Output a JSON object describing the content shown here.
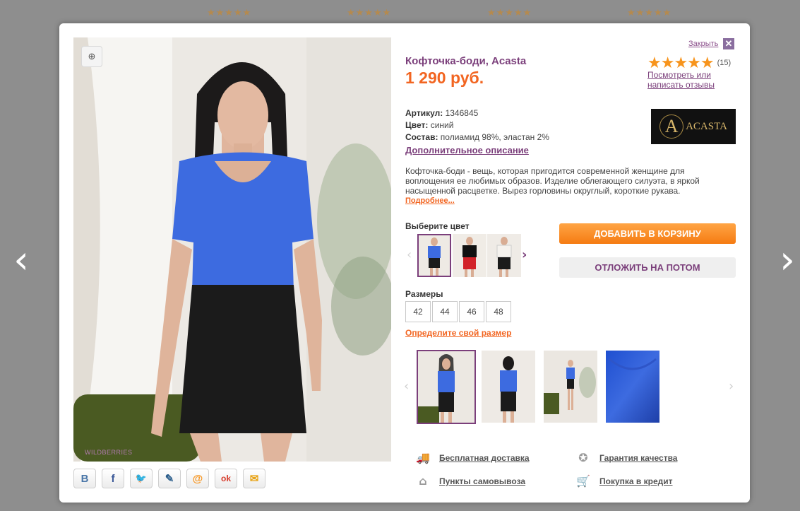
{
  "background": {
    "star_rows": [
      "★★★★★",
      "★★★★★",
      "★★★★★",
      "★★★★★"
    ],
    "prev_arrow": "‹",
    "next_arrow": "›"
  },
  "modal": {
    "close_label": "Закрыть",
    "close_icon": "✕",
    "title": "Кофточка-боди, Acasta",
    "price": "1 290 руб.",
    "rating": {
      "stars": "★★★★★",
      "count": "(15)",
      "link": "Посмотреть или написать отзывы"
    },
    "brand": {
      "monogram": "A",
      "name": "ACASTA"
    },
    "specs": [
      {
        "label": "Артикул:",
        "value": "1346845"
      },
      {
        "label": "Цвет:",
        "value": "синий"
      },
      {
        "label": "Состав:",
        "value": "полиамид 98%, эластан 2%"
      }
    ],
    "more_description": "Дополнительное описание",
    "description": "Кофточка-боди - вещь, которая пригодится современной женщине для воплощения ее любимых образов. Изделие облегающего силуэта, в яркой насыщенной расцветке. Вырез горловины округлый, короткие рукава.",
    "read_more": "Подробнее...",
    "color_label": "Выберите цвет",
    "colors": [
      "синий",
      "красный",
      "белый"
    ],
    "add_to_cart": "ДОБАВИТЬ В КОРЗИНУ",
    "save_later": "ОТЛОЖИТЬ НА ПОТОМ",
    "sizes_label": "Размеры",
    "sizes": [
      "42",
      "44",
      "46",
      "48"
    ],
    "size_help": "Определите свой размер",
    "watermark": "WILDBERRIES",
    "zoom_icon": "⊕",
    "services": [
      {
        "icon": "delivery-truck-icon",
        "label": "Бесплатная доставка"
      },
      {
        "icon": "quality-badge-icon",
        "label": "Гарантия качества"
      },
      {
        "icon": "pickup-point-icon",
        "label": "Пункты самовывоза"
      },
      {
        "icon": "credit-cart-icon",
        "label": "Покупка в кредит"
      }
    ],
    "share": [
      {
        "name": "vk",
        "glyph": "B",
        "color": "#4a76a8"
      },
      {
        "name": "facebook",
        "glyph": "f",
        "color": "#3b5998"
      },
      {
        "name": "twitter",
        "glyph": "🐦",
        "color": "#1da1f2"
      },
      {
        "name": "livejournal",
        "glyph": "✎",
        "color": "#2b5e8c"
      },
      {
        "name": "mail",
        "glyph": "@",
        "color": "#f7941d"
      },
      {
        "name": "odnoklassniki",
        "glyph": "ok",
        "color": "#d73b2b"
      },
      {
        "name": "email",
        "glyph": "✉",
        "color": "#e8a315"
      }
    ],
    "colors_hex": {
      "accent": "#f26521",
      "purple": "#7b3f7b",
      "blue_top": "#3d6be0"
    }
  }
}
